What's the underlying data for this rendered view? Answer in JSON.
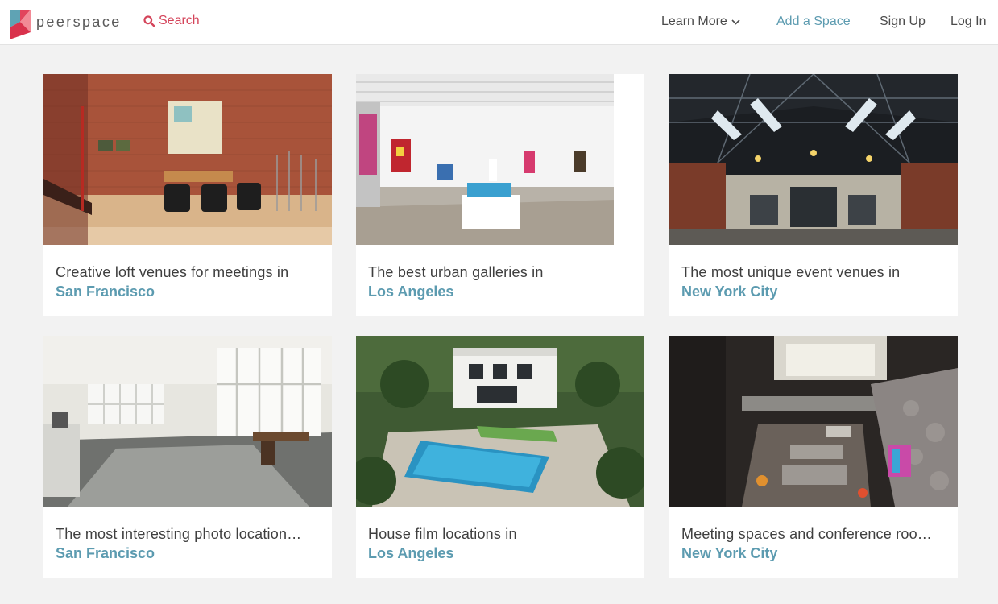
{
  "header": {
    "brand": "peerspace",
    "search_label": "Search",
    "nav": {
      "learn_more": "Learn More",
      "add_space": "Add a Space",
      "sign_up": "Sign Up",
      "log_in": "Log In"
    },
    "colors": {
      "accent": "#d4445a",
      "link": "#5c9bb0"
    }
  },
  "cards": [
    {
      "headline": "Creative loft venues for meetings in",
      "city": "San Francisco"
    },
    {
      "headline": "The best urban galleries in",
      "city": "Los Angeles"
    },
    {
      "headline": "The most unique event venues in",
      "city": "New York City"
    },
    {
      "headline": "The most interesting photo location…",
      "city": "San Francisco"
    },
    {
      "headline": "House film locations in",
      "city": "Los Angeles"
    },
    {
      "headline": "Meeting spaces and conference roo…",
      "city": "New York City"
    }
  ]
}
